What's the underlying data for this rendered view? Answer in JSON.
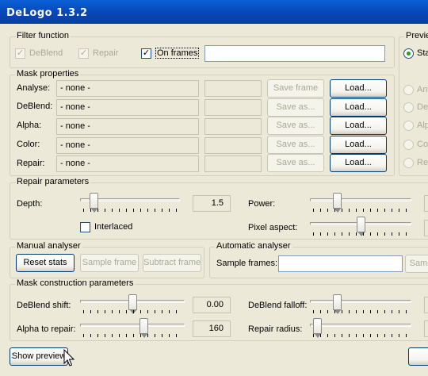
{
  "window": {
    "title": "DeLogo 1.3.2"
  },
  "filter_function": {
    "legend": "Filter function",
    "deblend": "DeBlend",
    "repair": "Repair",
    "on_frames": "On frames",
    "frames_value": ""
  },
  "preview": {
    "legend": "Previe",
    "radios": [
      "Sta",
      "Ana",
      "De",
      "Alp",
      "Col",
      "Re"
    ]
  },
  "mask_properties": {
    "legend": "Mask properties",
    "rows": [
      {
        "label": "Analyse:",
        "value": "- none -",
        "save": "Save frame",
        "load": "Load..."
      },
      {
        "label": "DeBlend:",
        "value": "- none -",
        "save": "Save as...",
        "load": "Load..."
      },
      {
        "label": "Alpha:",
        "value": "- none -",
        "save": "Save as...",
        "load": "Load..."
      },
      {
        "label": "Color:",
        "value": "- none -",
        "save": "Save as...",
        "load": "Load..."
      },
      {
        "label": "Repair:",
        "value": "- none -",
        "save": "Save as...",
        "load": "Load..."
      }
    ]
  },
  "repair_parameters": {
    "legend": "Repair parameters",
    "depth_label": "Depth:",
    "depth_value": "1.5",
    "depth_level": 0.1,
    "interlaced": "Interlaced",
    "power_label": "Power:",
    "power_level": 0.25,
    "pixel_aspect_label": "Pixel aspect:",
    "pixel_aspect_level": 0.5
  },
  "manual_analyser": {
    "legend": "Manual analyser",
    "reset": "Reset stats",
    "sample": "Sample frame",
    "subtract": "Subtract frame"
  },
  "automatic_analyser": {
    "legend": "Automatic analyser",
    "sample_frames_label": "Sample frames:",
    "sample_frames_value": "",
    "sample_button": "Samp"
  },
  "mask_construction": {
    "legend": "Mask construction parameters",
    "deblend_shift_label": "DeBlend shift:",
    "deblend_shift_value": "0.00",
    "deblend_shift_level": 0.5,
    "alpha_label": "Alpha to repair:",
    "alpha_value": "160",
    "alpha_level": 0.62,
    "deblend_falloff_label": "DeBlend falloff:",
    "deblend_falloff_level": 0.25,
    "repair_radius_label": "Repair radius:",
    "repair_radius_level": 0.03
  },
  "footer": {
    "show_preview": "Show preview"
  }
}
